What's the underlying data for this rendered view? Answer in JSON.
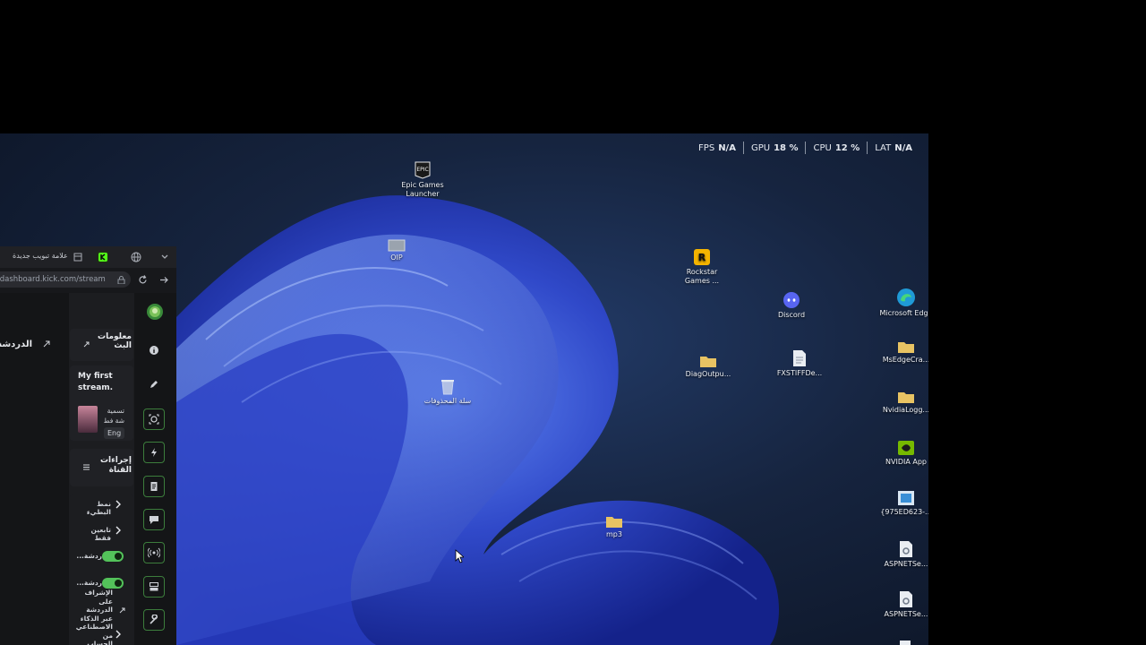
{
  "hud": {
    "fps_label": "FPS",
    "fps_value": "N/A",
    "gpu_label": "GPU",
    "gpu_value": "18 %",
    "cpu_label": "CPU",
    "cpu_value": "12 %",
    "lat_label": "LAT",
    "lat_value": "N/A"
  },
  "desktop": {
    "icons": [
      {
        "label": "Epic Games Launcher",
        "icon": "epic-games-icon"
      },
      {
        "label": "OIP",
        "icon": "image-file-icon"
      },
      {
        "label": "سلة المحذوفات",
        "icon": "recycle-bin-icon"
      },
      {
        "label": "mp3",
        "icon": "folder-icon"
      },
      {
        "label": "Rockstar Games ...",
        "icon": "rockstar-icon"
      },
      {
        "label": "DiagOutpu...",
        "icon": "folder-icon"
      },
      {
        "label": "Discord",
        "icon": "discord-icon"
      },
      {
        "label": "FXSTIFFDe...",
        "icon": "document-icon"
      },
      {
        "label": "Microsoft Edge",
        "icon": "edge-icon"
      },
      {
        "label": "MsEdgeCra...",
        "icon": "folder-icon"
      },
      {
        "label": "NvidiaLogg...",
        "icon": "folder-icon"
      },
      {
        "label": "NVIDIA App",
        "icon": "nvidia-icon"
      },
      {
        "label": "{975ED623-...",
        "icon": "app-file-icon"
      },
      {
        "label": "ASPNETSe...",
        "icon": "config-file-icon"
      },
      {
        "label": "ASPNETSe...",
        "icon": "config-file-icon"
      }
    ]
  },
  "browser": {
    "tab_label": "علامة تبويب جديدة",
    "url": "//dashboard.kick.com/stream",
    "sections": {
      "chat_title": "الدردشة",
      "stream_info_title": "معلومات البث",
      "stream_title": "My first stream.",
      "category_label": "تسمية شة فط",
      "language_tag": "Eng",
      "channel_actions_title": "إجراءات القناة",
      "action_slow_mode": "نمط البطيء",
      "action_followers_only": "تابعين فقط",
      "action_chat": "ردشة...",
      "action_chat_moderation": "ردشة...",
      "action_ai_moderation": "الإشراف على الدردشة عبر الذكاء الاصطناعي من الحساب"
    },
    "toggles": {
      "chat": true,
      "chat_moderation": true
    }
  },
  "colors": {
    "accent": "#53fc18",
    "toggle_on": "#53c25a"
  }
}
